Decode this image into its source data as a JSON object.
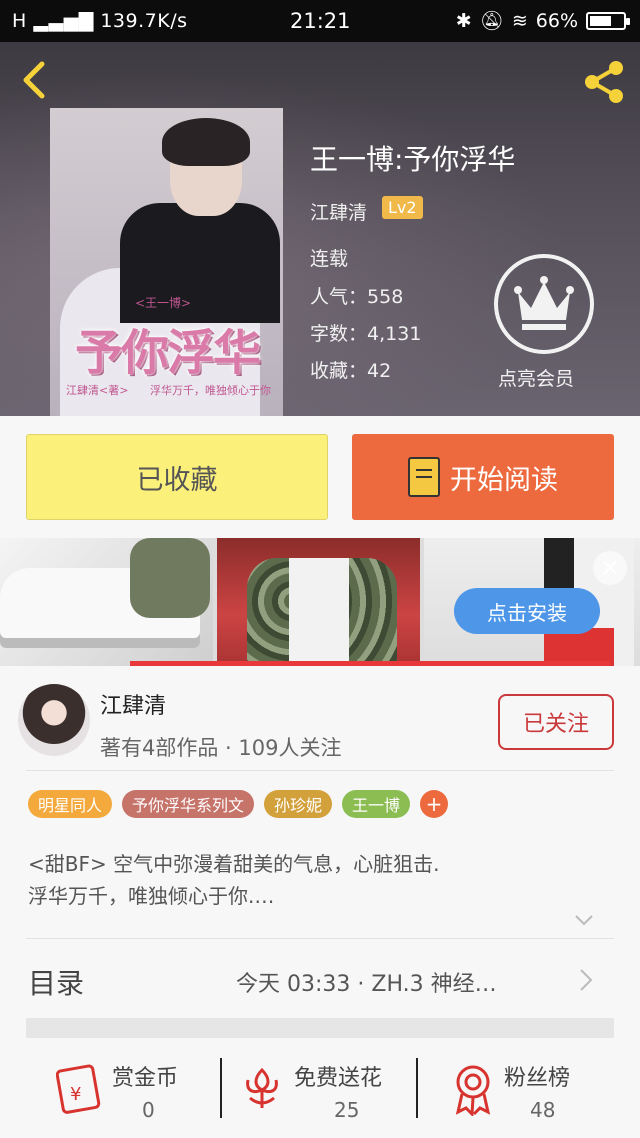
{
  "status_bar": {
    "signal": "H",
    "net_speed": "139.7K/s",
    "time": "21:21",
    "battery": "66%",
    "battery_level": 0.66
  },
  "book": {
    "title": "王一博:予你浮华",
    "author": "江肆清",
    "level": "Lv2",
    "status": "连载",
    "popularity_label": "人气：",
    "popularity": "558",
    "words_label": "字数：",
    "words": "4,131",
    "favorites_label": "收藏：",
    "favorites": "42",
    "cover_title": "予你浮华",
    "cover_small_top": "<王一博>",
    "cover_small_left": "江肆清<著>",
    "cover_small_right": "浮华万千，唯独倾心于你"
  },
  "vip": {
    "label": "点亮会员"
  },
  "actions": {
    "favorited_label": "已收藏",
    "start_read_label": "开始阅读"
  },
  "ad": {
    "close_glyph": "×",
    "install_label": "点击安装"
  },
  "author": {
    "name": "江肆清",
    "meta": "著有4部作品 · 109人关注",
    "follow_label": "已关注"
  },
  "tags": [
    {
      "label": "明星同人",
      "color": "#f3a93b"
    },
    {
      "label": "予你浮华系列文",
      "color": "#c6736a"
    },
    {
      "label": "孙珍妮",
      "color": "#d3a13c"
    },
    {
      "label": "王一博",
      "color": "#8bbd52"
    }
  ],
  "tag_add": "+",
  "description": "<甜BF> 空气中弥漫着甜美的气息，心脏狙击.\n浮华万千，唯独倾心于你.…",
  "toc": {
    "label": "目录",
    "latest": "今天 03:33 · ZH.3  神经…"
  },
  "bottom_stats": [
    {
      "label": "赏金币",
      "value": "0",
      "icon": "red-envelope-icon"
    },
    {
      "label": "免费送花",
      "value": "25",
      "icon": "flower-icon"
    },
    {
      "label": "粉丝榜",
      "value": "48",
      "icon": "medal-icon"
    }
  ],
  "colors": {
    "accent_orange": "#ec6a3e",
    "fav_yellow": "#fbf07a",
    "follow_red": "#c9383a",
    "icon_red": "#d8342f",
    "header_yellow": "#f5d13a"
  }
}
